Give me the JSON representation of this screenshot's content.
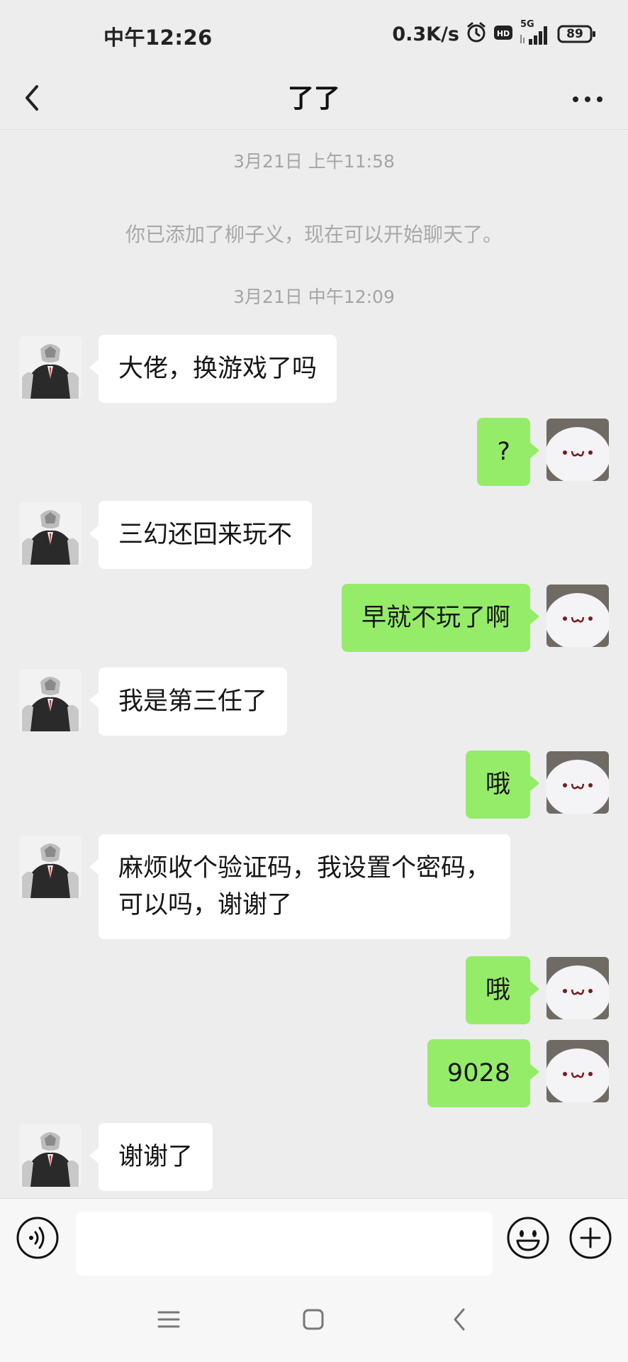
{
  "status_bar": {
    "time": "中午12:26",
    "net_speed": "0.3K/s",
    "network_type": "5G",
    "battery": "89",
    "icons": [
      "alarm-icon",
      "hd-icon",
      "signal-icon",
      "battery-icon"
    ]
  },
  "header": {
    "title": "了了",
    "back_icon": "chevron-left-icon",
    "more_icon": "more-dots-icon"
  },
  "chat": {
    "timestamp_1": "3月21日 上午11:58",
    "system_notice": "你已添加了柳子义，现在可以开始聊天了。",
    "timestamp_2": "3月21日 中午12:09",
    "messages": [
      {
        "side": "in",
        "text": "大佬，换游戏了吗"
      },
      {
        "side": "out",
        "text": "?"
      },
      {
        "side": "in",
        "text": "三幻还回来玩不"
      },
      {
        "side": "out",
        "text": "早就不玩了啊"
      },
      {
        "side": "in",
        "text": "我是第三任了"
      },
      {
        "side": "out",
        "text": "哦"
      },
      {
        "side": "in",
        "text": "麻烦收个验证码，我设置个密码，\n可以吗，谢谢了"
      },
      {
        "side": "out",
        "text": "哦"
      },
      {
        "side": "out",
        "text": "9028"
      },
      {
        "side": "in",
        "text": "谢谢了"
      }
    ]
  },
  "input_bar": {
    "message_placeholder": "",
    "icons": [
      "voice-icon",
      "emoji-icon",
      "plus-icon"
    ]
  },
  "nav_bar": {
    "icons": [
      "menu-icon",
      "home-icon",
      "back-icon"
    ]
  },
  "colors": {
    "background": "#ededed",
    "outgoing_bubble": "#95ec69",
    "incoming_bubble": "#ffffff",
    "muted_text": "#a4a4a4"
  }
}
